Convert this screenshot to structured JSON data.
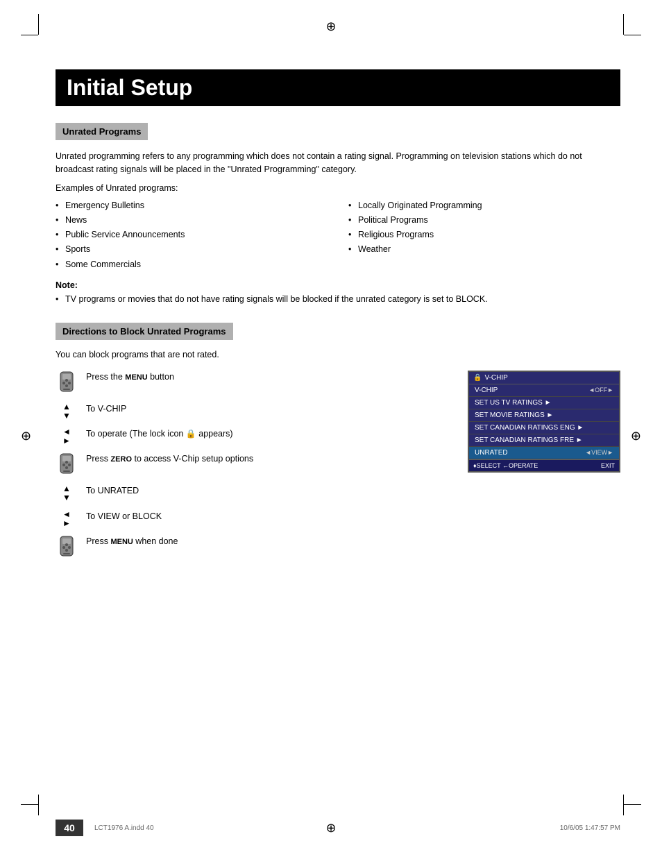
{
  "page": {
    "title": "Initial Setup",
    "page_number": "40",
    "footer_left": "LCT1976 A.indd  40",
    "footer_right": "10/6/05  1:47:57 PM",
    "reg_symbol": "⊕"
  },
  "unrated_section": {
    "header": "Unrated Programs",
    "intro": "Unrated programming refers to any programming which does not contain a rating signal. Programming on television stations which do not broadcast rating signals will be placed in the \"Unrated Programming\" category.",
    "examples_label": "Examples of Unrated programs:",
    "list_left": [
      "Emergency Bulletins",
      "News",
      "Public Service Announcements",
      "Sports",
      "Some Commercials"
    ],
    "list_right": [
      "Locally Originated Programming",
      "Political Programs",
      "Religious Programs",
      "Weather"
    ],
    "note_label": "Note:",
    "note_text": "TV programs or movies that do not have rating signals will be blocked if the unrated category is set to BLOCK."
  },
  "directions_section": {
    "header": "Directions to Block Unrated Programs",
    "intro": "You can block programs that are not rated.",
    "steps": [
      {
        "type": "remote",
        "text": "Press the MENU button"
      },
      {
        "type": "updown",
        "text": "To V-CHIP"
      },
      {
        "type": "leftright",
        "text": "To operate (The lock icon   appears)"
      },
      {
        "type": "remote",
        "text": "Press ZERO to access V-Chip setup options"
      },
      {
        "type": "updown",
        "text": "To UNRATED"
      },
      {
        "type": "leftright",
        "text": "To VIEW or BLOCK"
      },
      {
        "type": "remote",
        "text": "Press MENU when done"
      }
    ],
    "vchip_screen": {
      "title": "V-CHIP",
      "title_icon": "🔒",
      "menu_items": [
        {
          "label": "V-CHIP",
          "value": "◄OFF►",
          "highlighted": false
        },
        {
          "label": "SET US TV RATINGS ►",
          "value": "",
          "highlighted": false
        },
        {
          "label": "SET MOVIE RATINGS ►",
          "value": "",
          "highlighted": false
        },
        {
          "label": "SET CANADIAN RATINGS ENG ►",
          "value": "",
          "highlighted": false
        },
        {
          "label": "SET CANADIAN RATINGS FRE ►",
          "value": "",
          "highlighted": false
        },
        {
          "label": "UNRATED",
          "value": "◄VIEW►",
          "highlighted": true
        }
      ],
      "footer_left": "♦SELECT ←OPERATE",
      "footer_right": "EXIT"
    }
  }
}
